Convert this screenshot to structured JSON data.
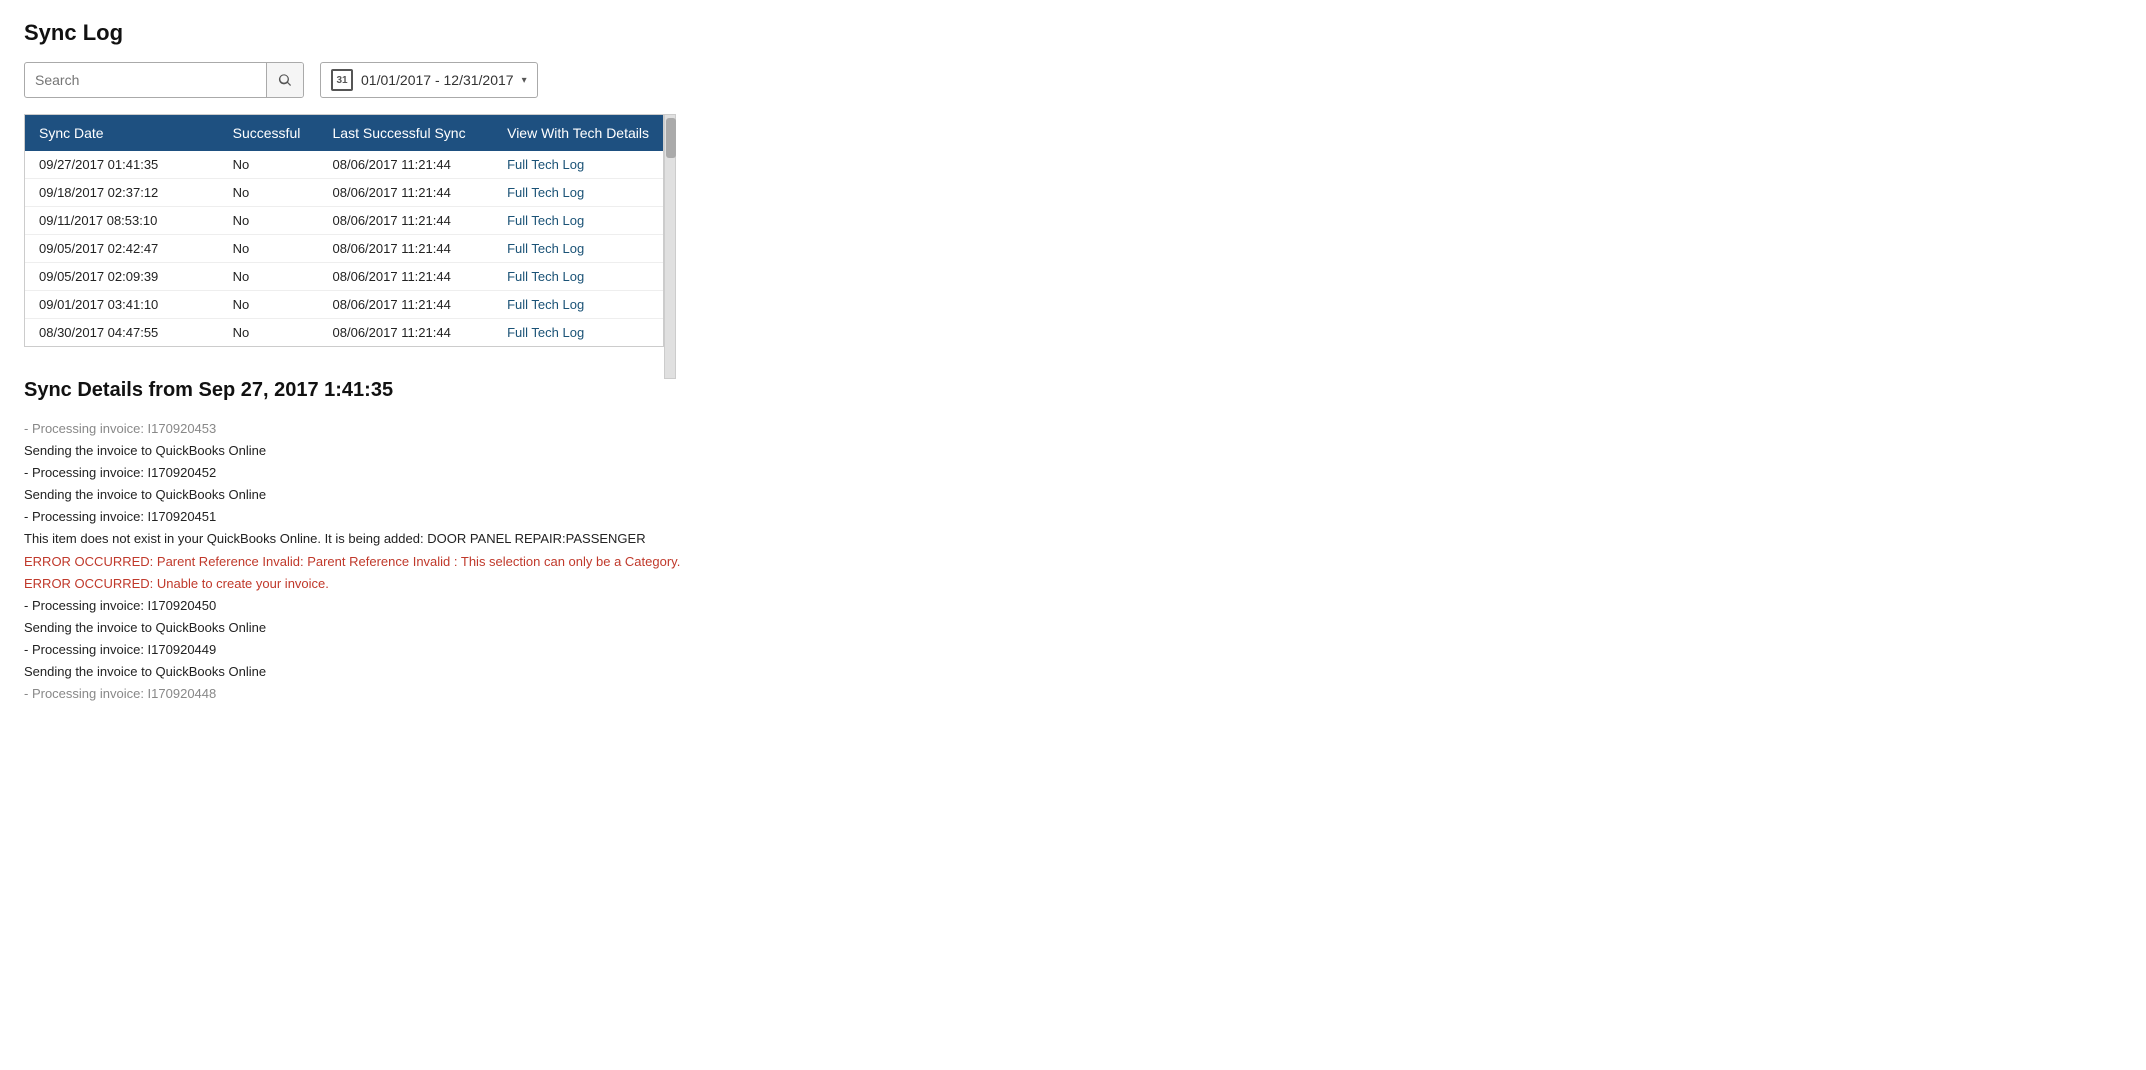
{
  "page": {
    "title": "Sync Log"
  },
  "toolbar": {
    "search_placeholder": "Search",
    "date_range": "01/01/2017 - 12/31/2017",
    "calendar_day": "31"
  },
  "table": {
    "columns": [
      "Sync Date",
      "Successful",
      "Last Successful Sync",
      "View With Tech Details"
    ],
    "rows": [
      {
        "sync_date": "09/27/2017 01:41:35",
        "successful": "No",
        "last_successful": "08/06/2017 11:21:44",
        "view": "Full Tech Log"
      },
      {
        "sync_date": "09/18/2017 02:37:12",
        "successful": "No",
        "last_successful": "08/06/2017 11:21:44",
        "view": "Full Tech Log"
      },
      {
        "sync_date": "09/11/2017 08:53:10",
        "successful": "No",
        "last_successful": "08/06/2017 11:21:44",
        "view": "Full Tech Log"
      },
      {
        "sync_date": "09/05/2017 02:42:47",
        "successful": "No",
        "last_successful": "08/06/2017 11:21:44",
        "view": "Full Tech Log"
      },
      {
        "sync_date": "09/05/2017 02:09:39",
        "successful": "No",
        "last_successful": "08/06/2017 11:21:44",
        "view": "Full Tech Log"
      },
      {
        "sync_date": "09/01/2017 03:41:10",
        "successful": "No",
        "last_successful": "08/06/2017 11:21:44",
        "view": "Full Tech Log"
      },
      {
        "sync_date": "08/30/2017 04:47:55",
        "successful": "No",
        "last_successful": "08/06/2017 11:21:44",
        "view": "Full Tech Log"
      }
    ]
  },
  "details": {
    "title": "Sync Details from Sep 27, 2017 1:41:35",
    "log_lines": [
      {
        "text": "- Processing invoice: I170920453",
        "type": "truncated"
      },
      {
        "text": "Sending the invoice to QuickBooks Online",
        "type": "normal"
      },
      {
        "text": "- Processing invoice: I170920452",
        "type": "normal"
      },
      {
        "text": "Sending the invoice to QuickBooks Online",
        "type": "normal"
      },
      {
        "text": "- Processing invoice: I170920451",
        "type": "normal"
      },
      {
        "text": "This item does not exist in your QuickBooks Online. It is being added: DOOR PANEL REPAIR:PASSENGER",
        "type": "normal"
      },
      {
        "text": "ERROR OCCURRED: Parent Reference Invalid: Parent Reference Invalid : This selection can only be a Category.",
        "type": "error"
      },
      {
        "text": "ERROR OCCURRED: Unable to create your invoice.",
        "type": "error"
      },
      {
        "text": "- Processing invoice: I170920450",
        "type": "normal"
      },
      {
        "text": "Sending the invoice to QuickBooks Online",
        "type": "normal"
      },
      {
        "text": "- Processing invoice: I170920449",
        "type": "normal"
      },
      {
        "text": "Sending the invoice to QuickBooks Online",
        "type": "normal"
      },
      {
        "text": "- Processing invoice: I170920448",
        "type": "truncated"
      }
    ]
  }
}
